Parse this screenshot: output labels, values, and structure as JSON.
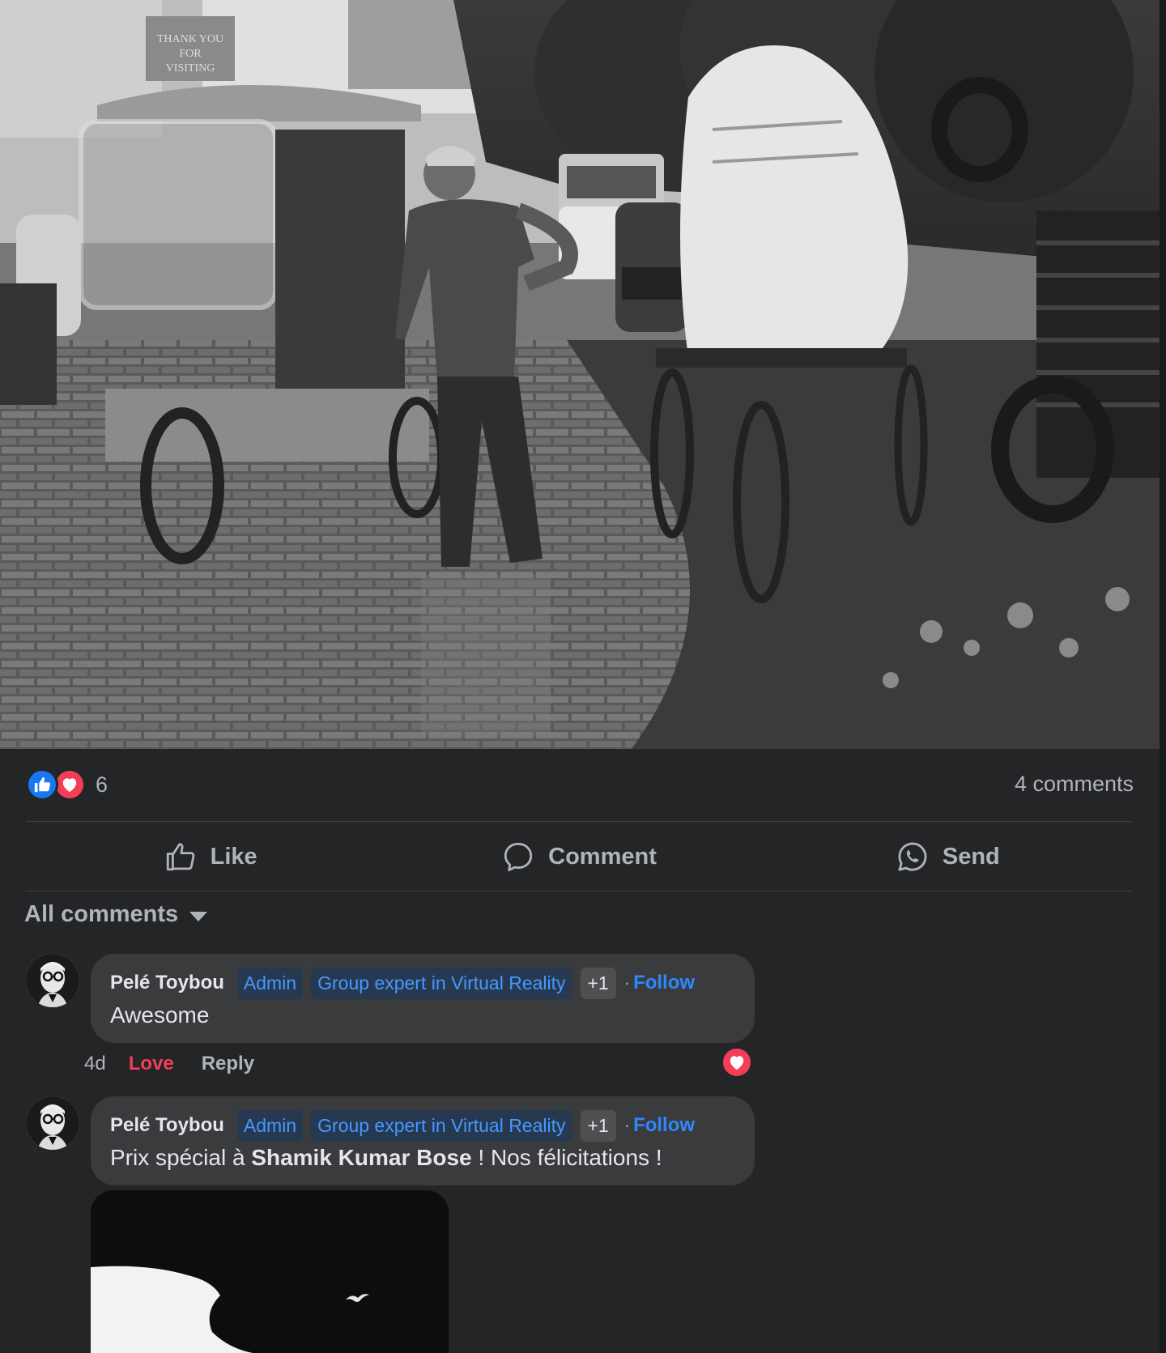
{
  "post": {
    "photo_icon": "street-scene-photo",
    "reactions": {
      "icons": [
        "like-icon",
        "love-icon"
      ],
      "count": "6"
    },
    "comments_count": "4 comments",
    "actions": {
      "like": "Like",
      "comment": "Comment",
      "send": "Send"
    },
    "sort_label": "All comments",
    "photo_signage": [
      "THANK YOU",
      "FOR",
      "VISITING"
    ]
  },
  "comments": [
    {
      "author": "Pelé Toybou",
      "badges": [
        "Admin",
        "Group expert in Virtual Reality"
      ],
      "more_badges": "+1",
      "separator": "·",
      "follow": "Follow",
      "text": "Awesome",
      "time": "4d",
      "reaction_label": "Love",
      "reply": "Reply",
      "has_love_badge": true
    },
    {
      "author": "Pelé Toybou",
      "badges": [
        "Admin",
        "Group expert in Virtual Reality"
      ],
      "more_badges": "+1",
      "separator": "·",
      "follow": "Follow",
      "text_before": "Prix spécial à ",
      "text_bold": "Shamik Kumar Bose",
      "text_after": " ! Nos félicitations !"
    }
  ],
  "colors": {
    "background": "#242526",
    "bubble": "#3a3b3c",
    "like_blue": "#1877f2",
    "love_red": "#f33e58",
    "follow_blue": "#2d88ff",
    "badge_blue": "#4599ff",
    "muted_text": "#b0b3b8"
  }
}
